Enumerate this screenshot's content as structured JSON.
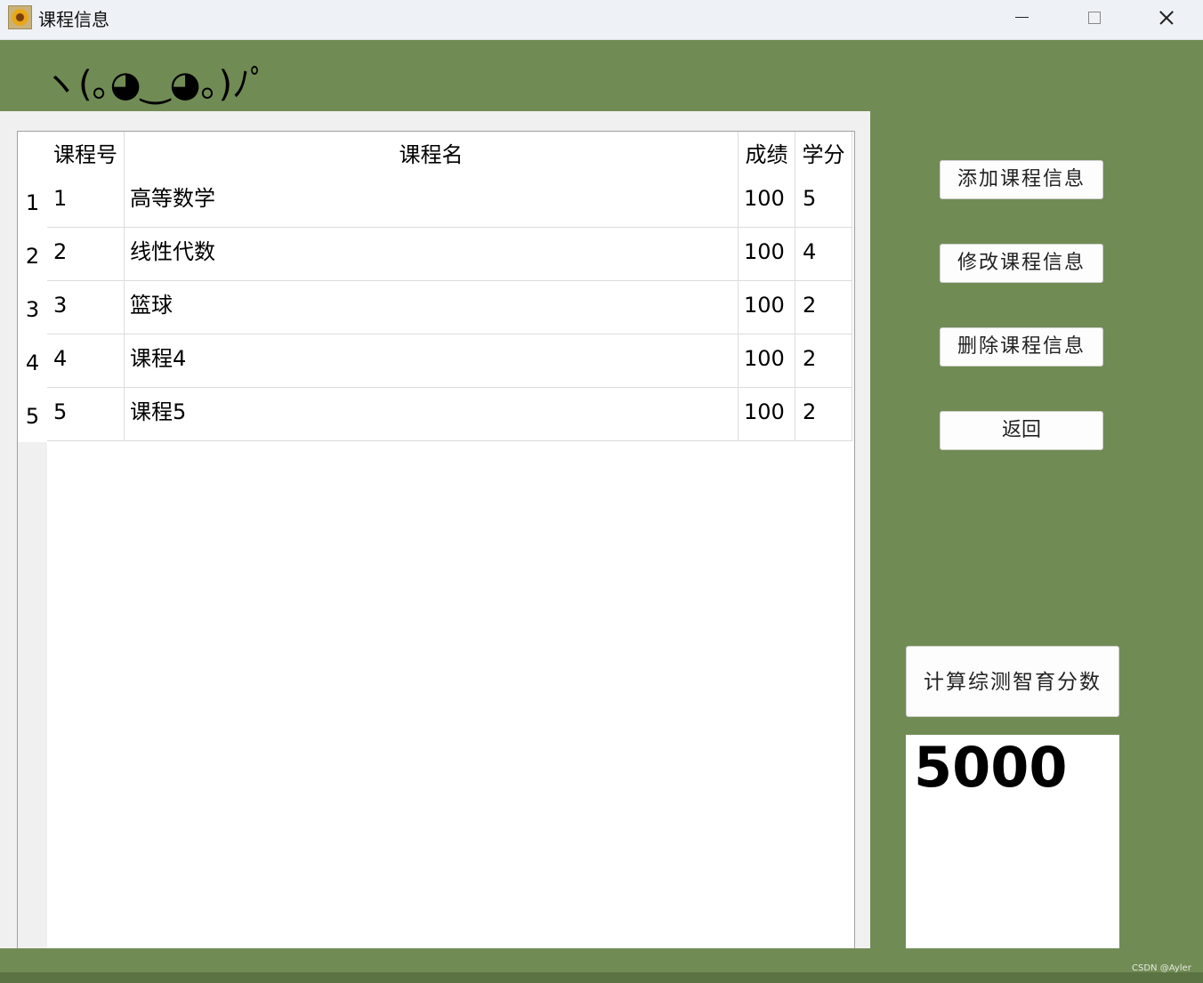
{
  "window": {
    "title": "课程信息",
    "icon": "sunflower-icon"
  },
  "header": {
    "kaomoji": "ヽ(｡◕‿◕｡)ﾉﾟ"
  },
  "table": {
    "columns": [
      "课程号",
      "课程名",
      "成绩",
      "学分"
    ],
    "row_numbers": [
      "1",
      "2",
      "3",
      "4",
      "5"
    ],
    "rows": [
      [
        "1",
        "高等数学",
        "100",
        "5"
      ],
      [
        "2",
        "线性代数",
        "100",
        "4"
      ],
      [
        "3",
        "篮球",
        "100",
        "2"
      ],
      [
        "4",
        "课程4",
        "100",
        "2"
      ],
      [
        "5",
        "课程5",
        "100",
        "2"
      ]
    ]
  },
  "buttons": {
    "add": "添加课程信息",
    "edit": "修改课程信息",
    "delete": "删除课程信息",
    "back": "返回",
    "calc": "计算综测智育分数"
  },
  "result": {
    "value": "5000"
  },
  "watermark": "CSDN @Ayler",
  "colors": {
    "background": "#718b55",
    "titlebar": "#eef2f6",
    "panel": "#f0f0f0"
  }
}
